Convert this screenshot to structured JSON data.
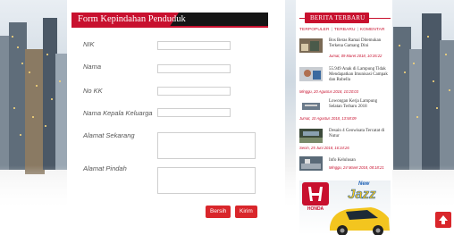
{
  "form": {
    "title": "Form Kepindahan Penduduk",
    "fields": {
      "nik": "NIK",
      "nama": "Nama",
      "no_kk": "No KK",
      "nama_kepala": "Nama Kepala Keluarga",
      "alamat_sekarang": "Alamat Sekarang",
      "alamat_pindah": "Alamat Pindah"
    },
    "buttons": {
      "reset": "Bersih",
      "submit": "Kirim"
    }
  },
  "sidebar": {
    "title": "BERITA TERBARU",
    "tabs": [
      "TERPOPULER",
      "TERBARU",
      "KOMENTAR"
    ],
    "news": [
      {
        "title": "Bos Beras Ramai Ditemukan Terkena Gamang Dini",
        "date": "Jumat, 09 Maret 2018, 10:35:22"
      },
      {
        "title": "55.949 Anak di Lampung Tidak Mendapatkan Imunisasi Campak dan Rubella",
        "date": "Minggu, 20 Agustus 2018, 10:20:03"
      },
      {
        "title": "Lowongan Kerja Lampung Selatan Terbaru 2018",
        "date": "Jumat, 10 Agustus 2018, 13:58:09"
      },
      {
        "title": "Desain 4 Geowisata Tercatat di Nutur",
        "date": "Senin, 25 Juni 2018, 16:34:26"
      },
      {
        "title": "Info Kelulusan",
        "date": "Minggu, 24 Maret 2018, 08:18:21"
      }
    ],
    "ad": {
      "brand": "HONDA",
      "tag": "New",
      "model": "Jazz"
    }
  },
  "colors": {
    "accent": "#c8102e",
    "dark": "#151515",
    "button": "#d9262b"
  },
  "icons": {
    "scroll_top": "arrow-up-icon"
  }
}
